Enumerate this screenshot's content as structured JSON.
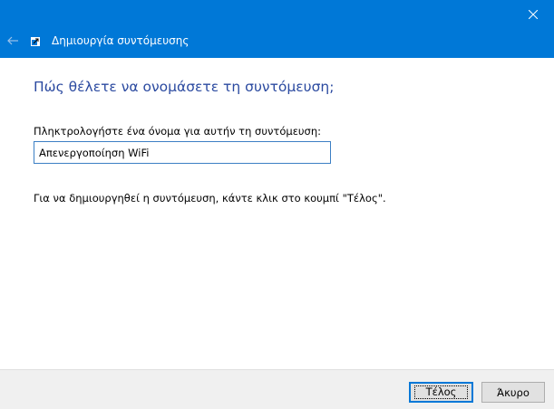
{
  "window": {
    "title": "Δημιουργία συντόμευσης"
  },
  "main": {
    "heading": "Πώς θέλετε να ονομάσετε τη συντόμευση;",
    "name_label": "Πληκτρολογήστε ένα όνομα για αυτήν τη συντόμευση:",
    "name_value": "Απενεργοποίηση WiFi",
    "hint": "Για να δημιουργηθεί η συντόμευση, κάντε κλικ στο κουμπί \"Τέλος\"."
  },
  "footer": {
    "finish_label": "Τέλος",
    "cancel_label": "Άκυρο"
  },
  "icons": {
    "close": "close-icon",
    "back": "back-arrow-icon",
    "app": "shortcut-icon"
  },
  "colors": {
    "titlebar": "#0078d7",
    "heading": "#2b4aa0",
    "input_border": "#3c7fc4",
    "footer": "#f0f0f0"
  }
}
